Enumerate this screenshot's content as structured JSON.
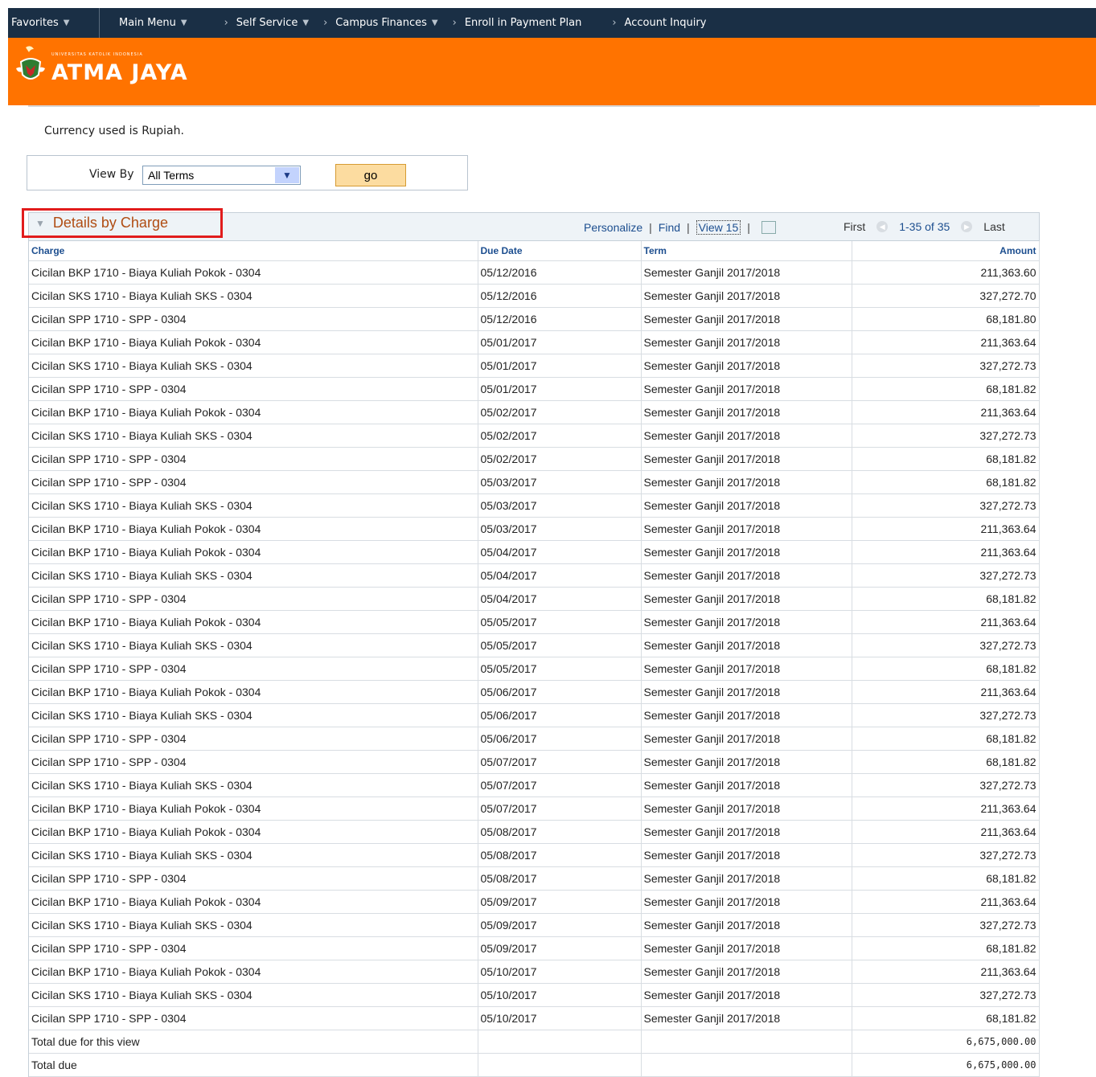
{
  "nav": {
    "favorites": "Favorites",
    "main_menu": "Main Menu",
    "breadcrumbs": [
      "Self Service",
      "Campus Finances",
      "Enroll in Payment Plan",
      "Account Inquiry"
    ]
  },
  "banner": {
    "logo_text": "ATMA JAYA",
    "logo_sub": "UNIVERSITAS KATOLIK INDONESIA",
    "accent_color": "#ff7300"
  },
  "currency_note": "Currency used is Rupiah.",
  "view_by": {
    "label": "View By",
    "selected": "All Terms",
    "go_label": "go"
  },
  "grid": {
    "title": "Details by Charge",
    "personalize": "Personalize",
    "find": "Find",
    "view_all": "View 15",
    "first": "First",
    "range": "1-35 of 35",
    "last": "Last",
    "columns": {
      "charge": "Charge",
      "due_date": "Due Date",
      "term": "Term",
      "amount": "Amount"
    },
    "rows": [
      [
        "Cicilan BKP 1710 - Biaya Kuliah Pokok - 0304",
        "05/12/2016",
        "Semester Ganjil 2017/2018",
        "211,363.60"
      ],
      [
        "Cicilan SKS 1710 - Biaya Kuliah SKS - 0304",
        "05/12/2016",
        "Semester Ganjil 2017/2018",
        "327,272.70"
      ],
      [
        "Cicilan SPP 1710 - SPP - 0304",
        "05/12/2016",
        "Semester Ganjil 2017/2018",
        "68,181.80"
      ],
      [
        "Cicilan BKP 1710 - Biaya Kuliah Pokok - 0304",
        "05/01/2017",
        "Semester Ganjil 2017/2018",
        "211,363.64"
      ],
      [
        "Cicilan SKS 1710 - Biaya Kuliah SKS - 0304",
        "05/01/2017",
        "Semester Ganjil 2017/2018",
        "327,272.73"
      ],
      [
        "Cicilan SPP 1710 - SPP - 0304",
        "05/01/2017",
        "Semester Ganjil 2017/2018",
        "68,181.82"
      ],
      [
        "Cicilan BKP 1710 - Biaya Kuliah Pokok - 0304",
        "05/02/2017",
        "Semester Ganjil 2017/2018",
        "211,363.64"
      ],
      [
        "Cicilan SKS 1710 - Biaya Kuliah SKS - 0304",
        "05/02/2017",
        "Semester Ganjil 2017/2018",
        "327,272.73"
      ],
      [
        "Cicilan SPP 1710 - SPP - 0304",
        "05/02/2017",
        "Semester Ganjil 2017/2018",
        "68,181.82"
      ],
      [
        "Cicilan SPP 1710 - SPP - 0304",
        "05/03/2017",
        "Semester Ganjil 2017/2018",
        "68,181.82"
      ],
      [
        "Cicilan SKS 1710 - Biaya Kuliah SKS - 0304",
        "05/03/2017",
        "Semester Ganjil 2017/2018",
        "327,272.73"
      ],
      [
        "Cicilan BKP 1710 - Biaya Kuliah Pokok - 0304",
        "05/03/2017",
        "Semester Ganjil 2017/2018",
        "211,363.64"
      ],
      [
        "Cicilan BKP 1710 - Biaya Kuliah Pokok - 0304",
        "05/04/2017",
        "Semester Ganjil 2017/2018",
        "211,363.64"
      ],
      [
        "Cicilan SKS 1710 - Biaya Kuliah SKS - 0304",
        "05/04/2017",
        "Semester Ganjil 2017/2018",
        "327,272.73"
      ],
      [
        "Cicilan SPP 1710 - SPP - 0304",
        "05/04/2017",
        "Semester Ganjil 2017/2018",
        "68,181.82"
      ],
      [
        "Cicilan BKP 1710 - Biaya Kuliah Pokok - 0304",
        "05/05/2017",
        "Semester Ganjil 2017/2018",
        "211,363.64"
      ],
      [
        "Cicilan SKS 1710 - Biaya Kuliah SKS - 0304",
        "05/05/2017",
        "Semester Ganjil 2017/2018",
        "327,272.73"
      ],
      [
        "Cicilan SPP 1710 - SPP - 0304",
        "05/05/2017",
        "Semester Ganjil 2017/2018",
        "68,181.82"
      ],
      [
        "Cicilan BKP 1710 - Biaya Kuliah Pokok - 0304",
        "05/06/2017",
        "Semester Ganjil 2017/2018",
        "211,363.64"
      ],
      [
        "Cicilan SKS 1710 - Biaya Kuliah SKS - 0304",
        "05/06/2017",
        "Semester Ganjil 2017/2018",
        "327,272.73"
      ],
      [
        "Cicilan SPP 1710 - SPP - 0304",
        "05/06/2017",
        "Semester Ganjil 2017/2018",
        "68,181.82"
      ],
      [
        "Cicilan SPP 1710 - SPP - 0304",
        "05/07/2017",
        "Semester Ganjil 2017/2018",
        "68,181.82"
      ],
      [
        "Cicilan SKS 1710 - Biaya Kuliah SKS - 0304",
        "05/07/2017",
        "Semester Ganjil 2017/2018",
        "327,272.73"
      ],
      [
        "Cicilan BKP 1710 - Biaya Kuliah Pokok - 0304",
        "05/07/2017",
        "Semester Ganjil 2017/2018",
        "211,363.64"
      ],
      [
        "Cicilan BKP 1710 - Biaya Kuliah Pokok - 0304",
        "05/08/2017",
        "Semester Ganjil 2017/2018",
        "211,363.64"
      ],
      [
        "Cicilan SKS 1710 - Biaya Kuliah SKS - 0304",
        "05/08/2017",
        "Semester Ganjil 2017/2018",
        "327,272.73"
      ],
      [
        "Cicilan SPP 1710 - SPP - 0304",
        "05/08/2017",
        "Semester Ganjil 2017/2018",
        "68,181.82"
      ],
      [
        "Cicilan BKP 1710 - Biaya Kuliah Pokok - 0304",
        "05/09/2017",
        "Semester Ganjil 2017/2018",
        "211,363.64"
      ],
      [
        "Cicilan SKS 1710 - Biaya Kuliah SKS - 0304",
        "05/09/2017",
        "Semester Ganjil 2017/2018",
        "327,272.73"
      ],
      [
        "Cicilan SPP 1710 - SPP - 0304",
        "05/09/2017",
        "Semester Ganjil 2017/2018",
        "68,181.82"
      ],
      [
        "Cicilan BKP 1710 - Biaya Kuliah Pokok - 0304",
        "05/10/2017",
        "Semester Ganjil 2017/2018",
        "211,363.64"
      ],
      [
        "Cicilan SKS 1710 - Biaya Kuliah SKS - 0304",
        "05/10/2017",
        "Semester Ganjil 2017/2018",
        "327,272.73"
      ],
      [
        "Cicilan SPP 1710 - SPP - 0304",
        "05/10/2017",
        "Semester Ganjil 2017/2018",
        "68,181.82"
      ]
    ],
    "totals": [
      {
        "label": "Total due for this view",
        "amount": "6,675,000.00"
      },
      {
        "label": "Total due",
        "amount": "6,675,000.00"
      }
    ]
  }
}
